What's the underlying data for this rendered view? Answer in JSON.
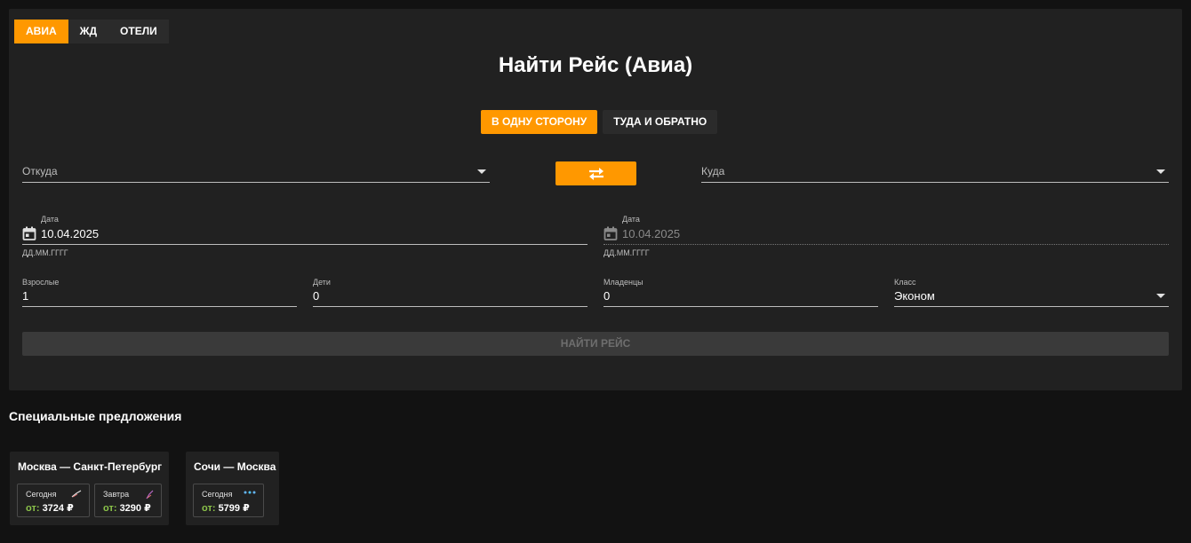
{
  "tabs": [
    {
      "label": "АВИА",
      "active": true
    },
    {
      "label": "ЖД",
      "active": false
    },
    {
      "label": "ОТЕЛИ",
      "active": false
    }
  ],
  "title": "Найти Рейс (Авиа)",
  "trip_type": {
    "one_way": "В ОДНУ СТОРОНУ",
    "round_trip": "ТУДА И ОБРАТНО",
    "selected": "one_way"
  },
  "from": {
    "label": "Откуда"
  },
  "to": {
    "label": "Куда"
  },
  "date_departure": {
    "label": "Дата",
    "value": "10.04.2025",
    "hint": "ДД.ММ.ГГГГ"
  },
  "date_return": {
    "label": "Дата",
    "value": "10.04.2025",
    "hint": "ДД.ММ.ГГГГ"
  },
  "passengers": {
    "adults": {
      "label": "Взрослые",
      "value": "1"
    },
    "children": {
      "label": "Дети",
      "value": "0"
    },
    "infants": {
      "label": "Младенцы",
      "value": "0"
    },
    "class": {
      "label": "Класс",
      "value": "Эконом"
    }
  },
  "search_button": "НАЙТИ РЕЙС",
  "offers": {
    "title": "Специальные предложения",
    "items": [
      {
        "route": "Москва — Санкт-Петербург",
        "prices": [
          {
            "day": "Сегодня",
            "from": "от:",
            "price": "3724 ₽"
          },
          {
            "day": "Завтра",
            "from": "от:",
            "price": "3290 ₽"
          }
        ]
      },
      {
        "route": "Сочи — Москва",
        "prices": [
          {
            "day": "Сегодня",
            "from": "от:",
            "price": "5799 ₽"
          }
        ]
      }
    ]
  },
  "colors": {
    "accent": "#ff9800",
    "background": "#121212",
    "panel": "#212121",
    "price_prefix": "#8bc34a"
  }
}
